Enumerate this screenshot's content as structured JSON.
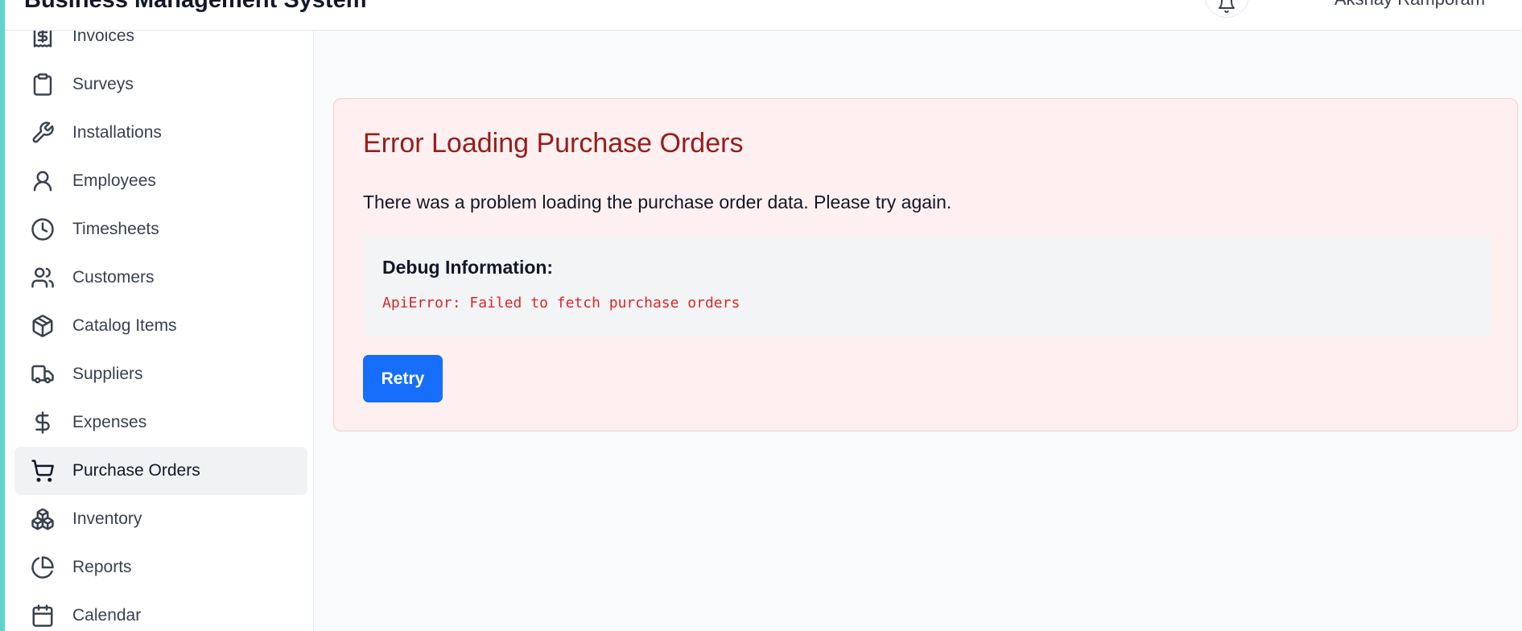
{
  "app": {
    "title": "Business Management System"
  },
  "header": {
    "user_name": "Akshay Ramporam",
    "notifications_icon": "bell-icon"
  },
  "sidebar": {
    "items": [
      {
        "label": "Invoices",
        "icon": "invoice-icon",
        "active": false
      },
      {
        "label": "Surveys",
        "icon": "clipboard-icon",
        "active": false
      },
      {
        "label": "Installations",
        "icon": "wrench-icon",
        "active": false
      },
      {
        "label": "Employees",
        "icon": "user-icon",
        "active": false
      },
      {
        "label": "Timesheets",
        "icon": "clock-icon",
        "active": false
      },
      {
        "label": "Customers",
        "icon": "users-icon",
        "active": false
      },
      {
        "label": "Catalog Items",
        "icon": "package-icon",
        "active": false
      },
      {
        "label": "Suppliers",
        "icon": "truck-icon",
        "active": false
      },
      {
        "label": "Expenses",
        "icon": "dollar-icon",
        "active": false
      },
      {
        "label": "Purchase Orders",
        "icon": "cart-icon",
        "active": true
      },
      {
        "label": "Inventory",
        "icon": "boxes-icon",
        "active": false
      },
      {
        "label": "Reports",
        "icon": "pie-chart-icon",
        "active": false
      },
      {
        "label": "Calendar",
        "icon": "calendar-icon",
        "active": false
      }
    ]
  },
  "error": {
    "title": "Error Loading Purchase Orders",
    "message": "There was a problem loading the purchase order data. Please try again.",
    "debug_title": "Debug Information:",
    "debug_message": "ApiError: Failed to fetch purchase orders",
    "retry_label": "Retry"
  },
  "colors": {
    "accent": "#5fd3d0",
    "error_text": "#991b1b",
    "error_bg": "#fef0f0",
    "debug_text": "#dc2626",
    "primary_button": "#166efa"
  }
}
